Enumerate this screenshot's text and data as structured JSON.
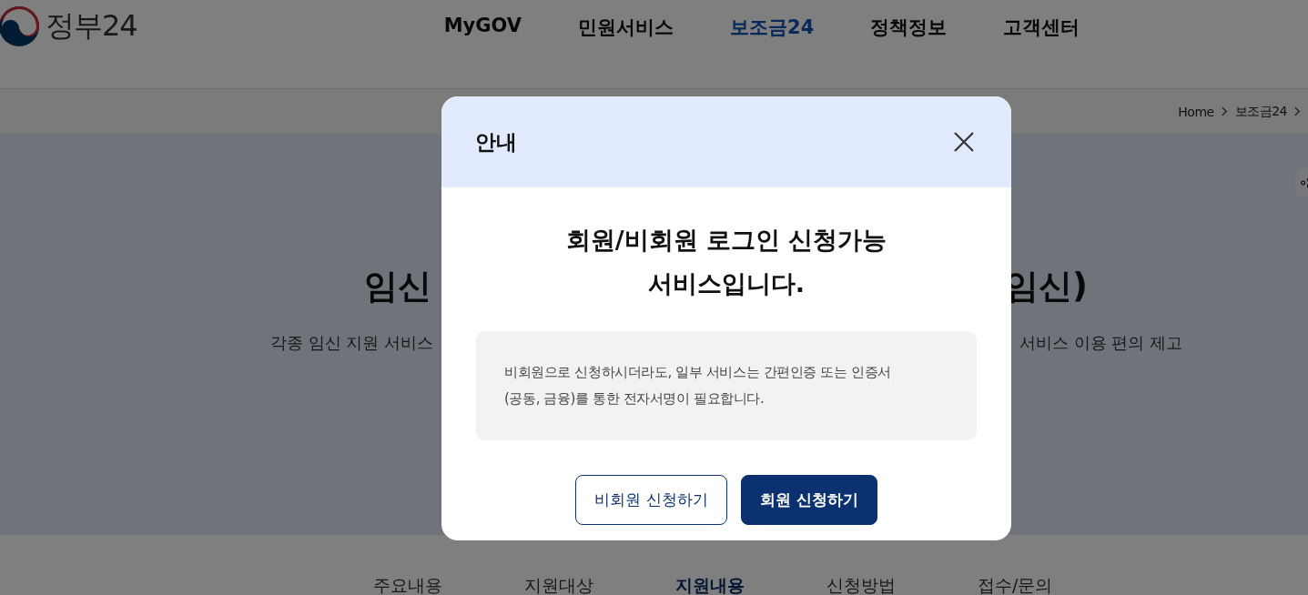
{
  "header": {
    "logo_text": "정부24",
    "nav": [
      {
        "label": "MyGOV",
        "selected": false
      },
      {
        "label": "민원서비스",
        "selected": false
      },
      {
        "label": "보조금24",
        "selected": true
      },
      {
        "label": "정책정보",
        "selected": false
      },
      {
        "label": "고객센터",
        "selected": false
      }
    ]
  },
  "breadcrumb": [
    "Home",
    "보조금24"
  ],
  "hero": {
    "title_left": "임신",
    "title_right": "임신)",
    "description_left": "각종 임신 지원 서비스",
    "description_right": "서비스 이용 편의 제고"
  },
  "section_tabs": [
    {
      "label": "주요내용",
      "selected": false
    },
    {
      "label": "지원대상",
      "selected": false
    },
    {
      "label": "지원내용",
      "selected": true
    },
    {
      "label": "신청방법",
      "selected": false
    },
    {
      "label": "접수/문의",
      "selected": false
    }
  ],
  "dialog": {
    "title": "안내",
    "heading": [
      "회원/비회원 로그인 신청가능",
      "서비스입니다."
    ],
    "notice": [
      "비회원으로 신청하시더라도, 일부 서비스는 간편인증 또는 인증서",
      "(공동, 금융)를 통한 전자서명이 필요합니다."
    ],
    "buttons": [
      {
        "label": "비회원 신청하기",
        "kind": "secondary"
      },
      {
        "label": "회원 신청하기",
        "kind": "primary"
      }
    ]
  }
}
